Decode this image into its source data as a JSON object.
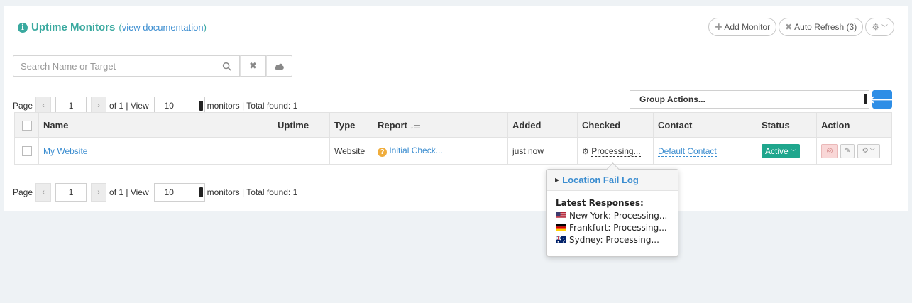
{
  "header": {
    "title": "Uptime Monitors",
    "doc_open": "(",
    "doc_link": "view documentation",
    "doc_close": ")",
    "add_monitor": "Add Monitor",
    "auto_refresh": "Auto Refresh (3)"
  },
  "search": {
    "placeholder": "Search Name or Target"
  },
  "pager": {
    "page_label": "Page",
    "page": "1",
    "of_text": "of 1 | View",
    "view": "10",
    "total_text": "monitors | Total found: 1"
  },
  "group_actions": "Group Actions...",
  "table": {
    "columns": [
      "Name",
      "Uptime",
      "Type",
      "Report",
      "Added",
      "Checked",
      "Contact",
      "Status",
      "Action"
    ],
    "rows": [
      {
        "name": "My Website",
        "uptime": "",
        "type": "Website",
        "report": "Initial Check...",
        "added": "just now",
        "checked": "Processing...",
        "contact": "Default Contact",
        "status": "Active"
      }
    ]
  },
  "popover": {
    "title": "Location Fail Log",
    "latest_label": "Latest Responses:",
    "locations": [
      {
        "text": "New York: Processing...",
        "flag": "us"
      },
      {
        "text": "Frankfurt: Processing...",
        "flag": "de"
      },
      {
        "text": "Sydney: Processing...",
        "flag": "au"
      }
    ]
  },
  "colors": {
    "accent": "#3aa99f",
    "link": "#3b8dd0",
    "active": "#1fa68d",
    "primary": "#2e8ee6"
  }
}
